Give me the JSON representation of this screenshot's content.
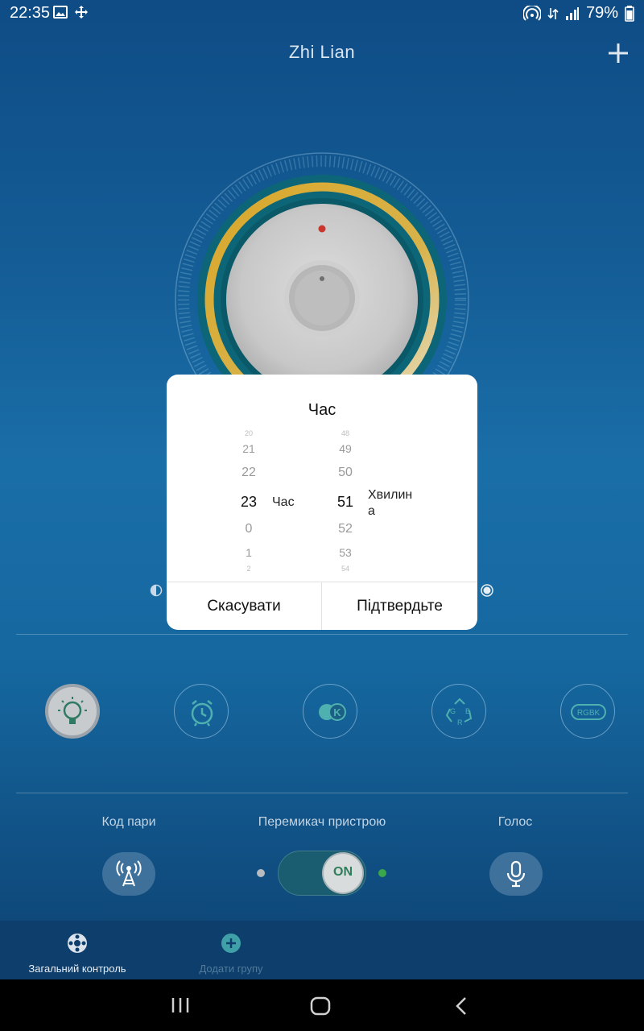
{
  "status_bar": {
    "time": "22:35",
    "battery": "79%"
  },
  "header": {
    "title": "Zhi Lian"
  },
  "dialog": {
    "title": "Час",
    "hours": [
      "20",
      "21",
      "22",
      "23",
      "0",
      "1",
      "2"
    ],
    "minutes": [
      "48",
      "49",
      "50",
      "51",
      "52",
      "53",
      "54"
    ],
    "hour_unit": "Час",
    "minute_unit_line1": "Хвилин",
    "minute_unit_line2": "а",
    "cancel_label": "Скасувати",
    "confirm_label": "Підтвердьте"
  },
  "controls": {
    "pair_label": "Код пари",
    "switch_label": "Перемикач пристрою",
    "switch_state": "ON",
    "voice_label": "Голос"
  },
  "tabs": [
    {
      "label": "Загальний контроль",
      "icon": "general-control-icon",
      "active": true
    },
    {
      "label": "Додати групу",
      "icon": "add-group-icon",
      "active": false
    }
  ],
  "modes": [
    {
      "icon": "light-bulb-icon",
      "active": true
    },
    {
      "icon": "alarm-clock-icon",
      "active": false
    },
    {
      "icon": "color-temperature-icon",
      "active": false
    },
    {
      "icon": "rgb-icon",
      "active": false
    },
    {
      "icon": "rgbk-icon",
      "active": false,
      "text": "RGBK"
    }
  ],
  "colors": {
    "accent_gold": "#d8a934",
    "switch_on": "#3aa84a"
  }
}
